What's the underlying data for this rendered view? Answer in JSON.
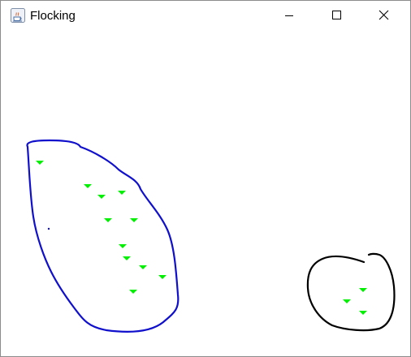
{
  "window": {
    "title": "Flocking",
    "app_icon": "java-cup-icon",
    "controls": {
      "minimize": "minimize-icon",
      "maximize": "maximize-icon",
      "close": "close-icon"
    }
  },
  "canvas": {
    "boid_color": "#00ee00",
    "flock_a_outline_color": "#1010cc",
    "flock_b_outline_color": "#000000",
    "flock_a_boid_count": 12,
    "flock_b_boid_count": 3
  }
}
